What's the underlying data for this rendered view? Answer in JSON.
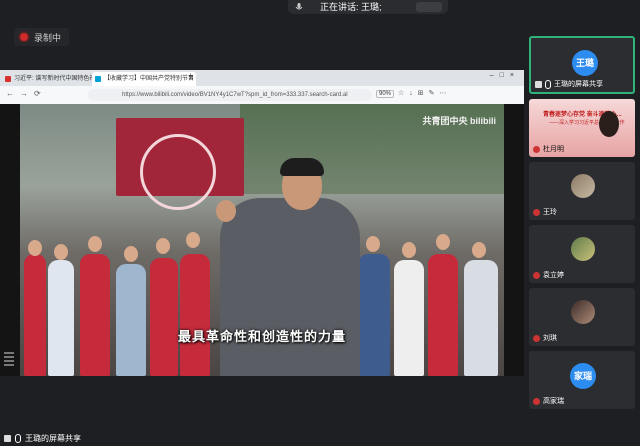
{
  "speaking": {
    "label": "正在讲话: 王璐;"
  },
  "recording": {
    "label": "录制中"
  },
  "browser": {
    "tabs": [
      {
        "title": "习近平: 谱写新时代中国特色社会",
        "color": "#d6312c"
      },
      {
        "title": "【收藏学习】中国共产党特别节目",
        "color": "#00a1d6"
      }
    ],
    "url": "https://www.bilibili.com/video/BV1NY4y1C7wT?spm_id_from=333.337.search-card.al",
    "zoom": "90%"
  },
  "video": {
    "subtitle": "最具革命性和创造性的力量",
    "logo": "共青团中央 bilibili"
  },
  "presenter_label": "王璐的屏幕共享",
  "participants": [
    {
      "name": "王璐的屏幕共享",
      "avatar": "王璐",
      "avatar_color": "#2d8cf0",
      "active": true
    },
    {
      "name": "杜月明",
      "screen": true,
      "screen_title": "青春逐梦心存党 奋斗逐梦心...",
      "screen_sub": "——深入学习习近平总书记... 工作"
    },
    {
      "name": "王玲",
      "camera": true
    },
    {
      "name": "袁立婷",
      "camera": true
    },
    {
      "name": "刘琪",
      "camera": true
    },
    {
      "name": "高家瑞",
      "avatar": "家瑞",
      "avatar_color": "#2d8cf0"
    }
  ]
}
